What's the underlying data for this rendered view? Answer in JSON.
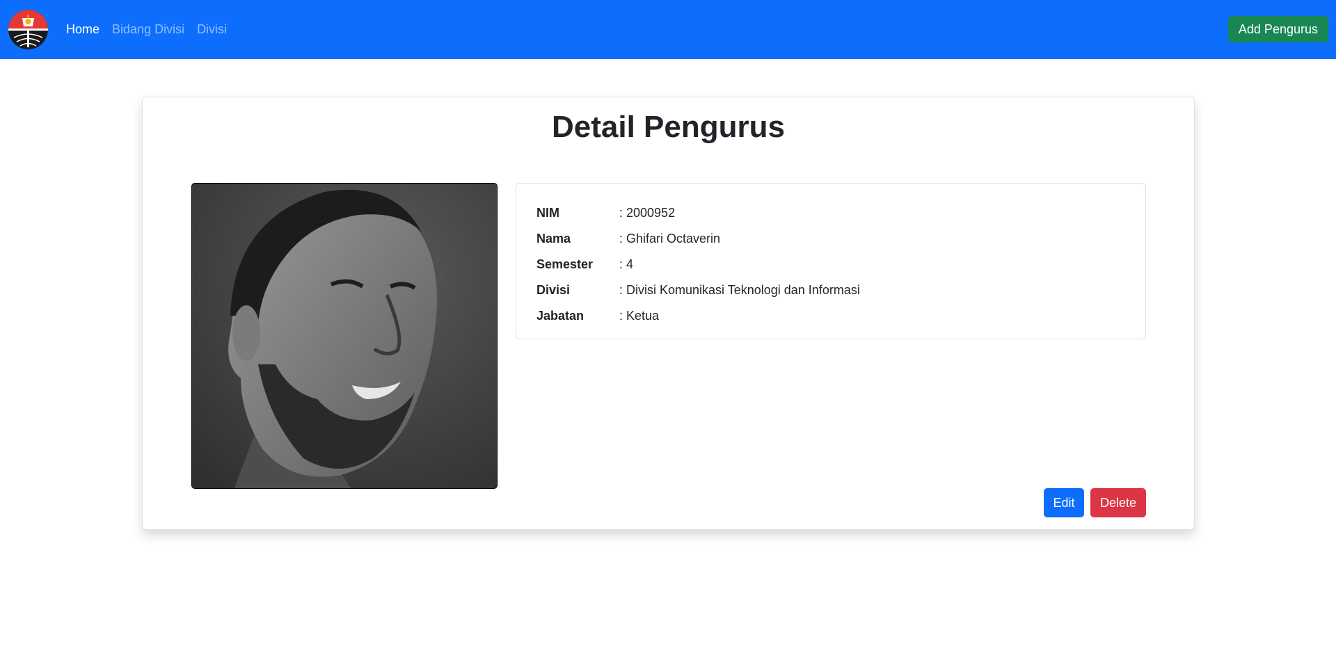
{
  "navbar": {
    "logo_alt": "university-logo",
    "links": [
      {
        "label": "Home",
        "active": true
      },
      {
        "label": "Bidang Divisi",
        "active": false
      },
      {
        "label": "Divisi",
        "active": false
      }
    ],
    "add_button_label": "Add Pengurus"
  },
  "card": {
    "title": "Detail Pengurus",
    "fields": [
      {
        "label": "NIM",
        "value": ": 2000952"
      },
      {
        "label": "Nama",
        "value": ": Ghifari Octaverin"
      },
      {
        "label": "Semester",
        "value": ": 4"
      },
      {
        "label": "Divisi",
        "value": ": Divisi Komunikasi Teknologi dan Informasi"
      },
      {
        "label": "Jabatan",
        "value": ": Ketua"
      }
    ],
    "edit_label": "Edit",
    "delete_label": "Delete"
  },
  "colors": {
    "primary": "#0d6efd",
    "success": "#198754",
    "danger": "#dc3545"
  }
}
